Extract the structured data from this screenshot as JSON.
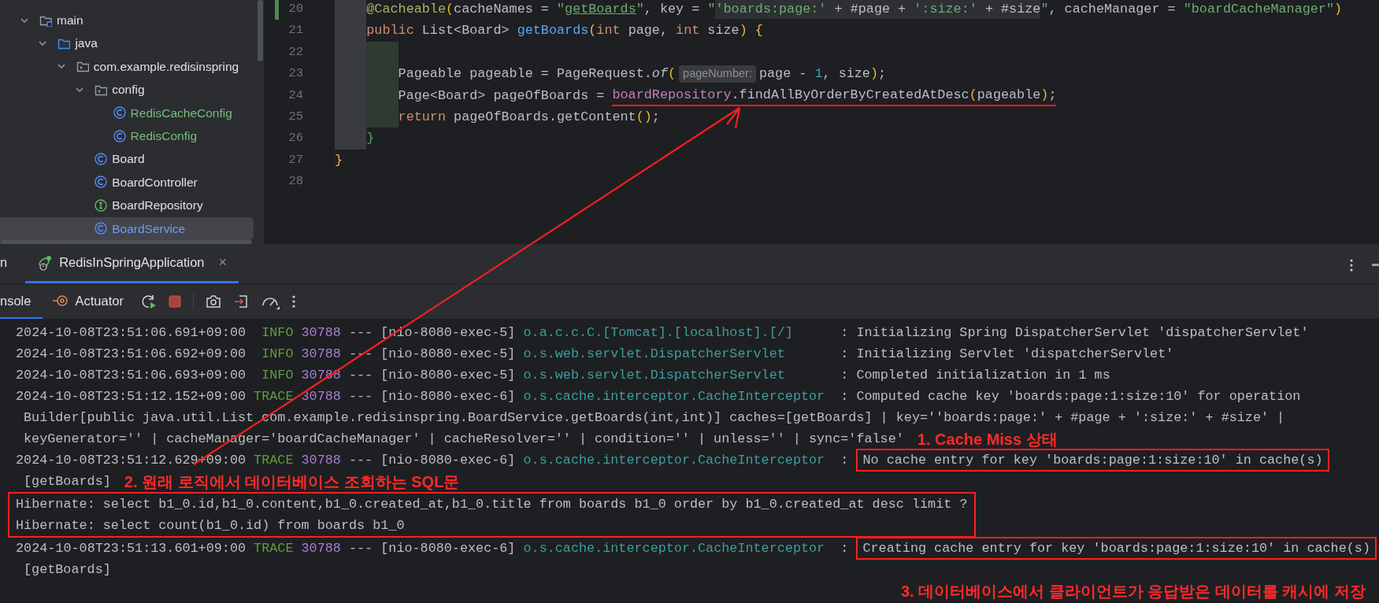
{
  "project_tree": {
    "items": [
      {
        "label": "main",
        "kind": "source-root",
        "expanded": true,
        "selected": false,
        "added": false,
        "children": [
          {
            "label": "java",
            "kind": "source-folder",
            "expanded": true,
            "selected": false,
            "added": false,
            "children": [
              {
                "label": "com.example.redisinspring",
                "kind": "package",
                "expanded": true,
                "selected": false,
                "added": false,
                "children": [
                  {
                    "label": "config",
                    "kind": "package",
                    "expanded": true,
                    "selected": false,
                    "added": false,
                    "children": [
                      {
                        "label": "RedisCacheConfig",
                        "kind": "class",
                        "selected": false,
                        "added": true
                      },
                      {
                        "label": "RedisConfig",
                        "kind": "class",
                        "selected": false,
                        "added": true
                      }
                    ]
                  },
                  {
                    "label": "Board",
                    "kind": "class",
                    "selected": false,
                    "added": false
                  },
                  {
                    "label": "BoardController",
                    "kind": "class",
                    "selected": false,
                    "added": false
                  },
                  {
                    "label": "BoardRepository",
                    "kind": "interface",
                    "selected": false,
                    "added": false
                  },
                  {
                    "label": "BoardService",
                    "kind": "class",
                    "selected": true,
                    "added": false
                  }
                ]
              }
            ]
          }
        ]
      }
    ]
  },
  "editor": {
    "lines": [
      {
        "children": [
          {
            "number": "20",
            "modified": true,
            "tokens": [
              {
                "kind": "annotation",
                "text": "@Cacheable"
              },
              {
                "kind": "bracket",
                "text": "("
              },
              {
                "kind": "plain",
                "text": "cacheNames = "
              },
              {
                "kind": "string",
                "text": "\""
              },
              {
                "kind": "string-ref",
                "text": "getBoards"
              },
              {
                "kind": "string",
                "text": "\""
              },
              {
                "kind": "plain",
                "text": ", key = "
              },
              {
                "kind": "string",
                "text": "\""
              },
              {
                "kind": "injected-string",
                "text": "'boards:page:'"
              },
              {
                "kind": "injected-plain",
                "text": " + #page + "
              },
              {
                "kind": "injected-string",
                "text": "':size:'"
              },
              {
                "kind": "injected-plain",
                "text": " + #size"
              },
              {
                "kind": "string",
                "text": "\""
              },
              {
                "kind": "plain",
                "text": ", cacheManager = "
              },
              {
                "kind": "string",
                "text": "\"boardCacheManager\""
              },
              {
                "kind": "bracket",
                "text": ")"
              }
            ]
          },
          {
            "number": "21",
            "modified": false,
            "tokens": [
              {
                "kind": "keyword",
                "text": "public"
              },
              {
                "kind": "plain",
                "text": " List<Board> "
              },
              {
                "kind": "method",
                "text": "getBoards"
              },
              {
                "kind": "bracket",
                "text": "("
              },
              {
                "kind": "keyword",
                "text": "int"
              },
              {
                "kind": "plain",
                "text": " page, "
              },
              {
                "kind": "keyword",
                "text": "int"
              },
              {
                "kind": "plain",
                "text": " size"
              },
              {
                "kind": "bracket",
                "text": ") {"
              }
            ],
            "children": [
              {
                "number": "22",
                "modified": false
              },
              {
                "number": "23",
                "modified": false,
                "tokens": [
                  {
                    "kind": "plain",
                    "text": "Pageable pageable = PageRequest."
                  },
                  {
                    "kind": "static",
                    "text": "of"
                  },
                  {
                    "kind": "bracket",
                    "text": "("
                  },
                  {
                    "kind": "hint",
                    "text": "pageNumber:"
                  },
                  {
                    "kind": "plain",
                    "text": "page - "
                  },
                  {
                    "kind": "number",
                    "text": "1"
                  },
                  {
                    "kind": "plain",
                    "text": ", size"
                  },
                  {
                    "kind": "bracket",
                    "text": ")"
                  },
                  {
                    "kind": "plain",
                    "text": ";"
                  }
                ]
              },
              {
                "number": "24",
                "modified": false,
                "tokens": [
                  {
                    "kind": "plain",
                    "text": "Page<Board> pageOfBoards = ",
                    "marked": false
                  },
                  {
                    "kind": "field",
                    "text": "boardRepository",
                    "marked": true
                  },
                  {
                    "kind": "plain",
                    "text": ".findAllByOrderByCreatedAtDesc",
                    "marked": true
                  },
                  {
                    "kind": "bracket",
                    "text": "(",
                    "marked": true
                  },
                  {
                    "kind": "plain",
                    "text": "pageable",
                    "marked": true
                  },
                  {
                    "kind": "bracket",
                    "text": ")",
                    "marked": true
                  },
                  {
                    "kind": "plain",
                    "text": ";",
                    "marked": true
                  }
                ]
              },
              {
                "number": "25",
                "modified": false,
                "tokens": [
                  {
                    "kind": "keyword",
                    "text": "return"
                  },
                  {
                    "kind": "plain",
                    "text": " pageOfBoards.getContent"
                  },
                  {
                    "kind": "bracket",
                    "text": "()"
                  },
                  {
                    "kind": "plain",
                    "text": ";"
                  }
                ]
              }
            ]
          },
          {
            "number": "26",
            "modified": false,
            "tokens": [
              {
                "kind": "bracket2",
                "text": "}"
              }
            ]
          }
        ]
      },
      {
        "number": "27",
        "modified": false,
        "tokens": [
          {
            "kind": "bracket",
            "text": "}"
          }
        ]
      },
      {
        "number": "28",
        "modified": false
      }
    ]
  },
  "tool_window": {
    "tabs": [
      {
        "label": "n",
        "selected": false,
        "closable": false
      },
      {
        "label": "RedisInSpringApplication",
        "selected": true,
        "closable": true
      }
    ],
    "close_mark": "×",
    "subtabs": [
      {
        "label": "nsole",
        "selected": true,
        "kind": "plain"
      },
      {
        "label": "Actuator",
        "selected": false,
        "kind": "actuator"
      }
    ]
  },
  "console": {
    "lines": [
      {
        "kind": "log",
        "timestamp": "2024-10-08T23:51:06.691+09:00",
        "level": "INFO",
        "pid": "30788",
        "separator": "---",
        "thread": "[nio-8080-exec-5]",
        "logger": "o.a.c.c.C.[Tomcat].[localhost].[/]",
        "colon": ":",
        "message": "Initializing Spring DispatcherServlet 'dispatcherServlet'",
        "boxed": false
      },
      {
        "kind": "log",
        "timestamp": "2024-10-08T23:51:06.692+09:00",
        "level": "INFO",
        "pid": "30788",
        "separator": "---",
        "thread": "[nio-8080-exec-5]",
        "logger": "o.s.web.servlet.DispatcherServlet",
        "colon": ":",
        "message": "Initializing Servlet 'dispatcherServlet'",
        "boxed": false
      },
      {
        "kind": "log",
        "timestamp": "2024-10-08T23:51:06.693+09:00",
        "level": "INFO",
        "pid": "30788",
        "separator": "---",
        "thread": "[nio-8080-exec-5]",
        "logger": "o.s.web.servlet.DispatcherServlet",
        "colon": ":",
        "message": "Completed initialization in 1 ms",
        "boxed": false
      },
      {
        "kind": "log",
        "timestamp": "2024-10-08T23:51:12.152+09:00",
        "level": "TRACE",
        "pid": "30788",
        "separator": "---",
        "thread": "[nio-8080-exec-6]",
        "logger": "o.s.cache.interceptor.CacheInterceptor",
        "colon": ":",
        "message": "Computed cache key 'boards:page:1:size:10' for operation",
        "boxed": false
      },
      {
        "kind": "continuation",
        "text": "Builder[public java.util.List com.example.redisinspring.BoardService.getBoards(int,int)] caches=[getBoards] | key=''boards:page:' + #page + ':size:' + #size' |"
      },
      {
        "kind": "continuation",
        "text": "keyGenerator='' | cacheManager='boardCacheManager' | cacheResolver='' | condition='' | unless='' | sync='false'",
        "note": "1. Cache Miss 상태"
      },
      {
        "kind": "log",
        "timestamp": "2024-10-08T23:51:12.629+09:00",
        "level": "TRACE",
        "pid": "30788",
        "separator": "---",
        "thread": "[nio-8080-exec-6]",
        "logger": "o.s.cache.interceptor.CacheInterceptor",
        "colon": ":",
        "message": "No cache entry for key 'boards:page:1:size:10' in cache(s)",
        "boxed": true
      },
      {
        "kind": "continuation",
        "text": "[getBoards]",
        "note": "2. 원래 로직에서 데이터베이스 조회하는 SQL문"
      },
      {
        "kind": "group",
        "boxed": true,
        "lines": [
          {
            "kind": "plain",
            "text": "Hibernate: select b1_0.id,b1_0.content,b1_0.created_at,b1_0.title from boards b1_0 order by b1_0.created_at desc limit ?"
          },
          {
            "kind": "plain",
            "text": "Hibernate: select count(b1_0.id) from boards b1_0"
          }
        ]
      },
      {
        "kind": "log",
        "timestamp": "2024-10-08T23:51:13.601+09:00",
        "level": "TRACE",
        "pid": "30788",
        "separator": "---",
        "thread": "[nio-8080-exec-6]",
        "logger": "o.s.cache.interceptor.CacheInterceptor",
        "colon": ":",
        "message": "Creating cache entry for key 'boards:page:1:size:10' in cache(s)",
        "boxed": true
      },
      {
        "kind": "continuation",
        "text": "[getBoards]"
      },
      {
        "kind": "note",
        "text": "3. 데이터베이스에서 클라이언트가 응답받은 데이터를 캐시에 저장"
      }
    ]
  }
}
